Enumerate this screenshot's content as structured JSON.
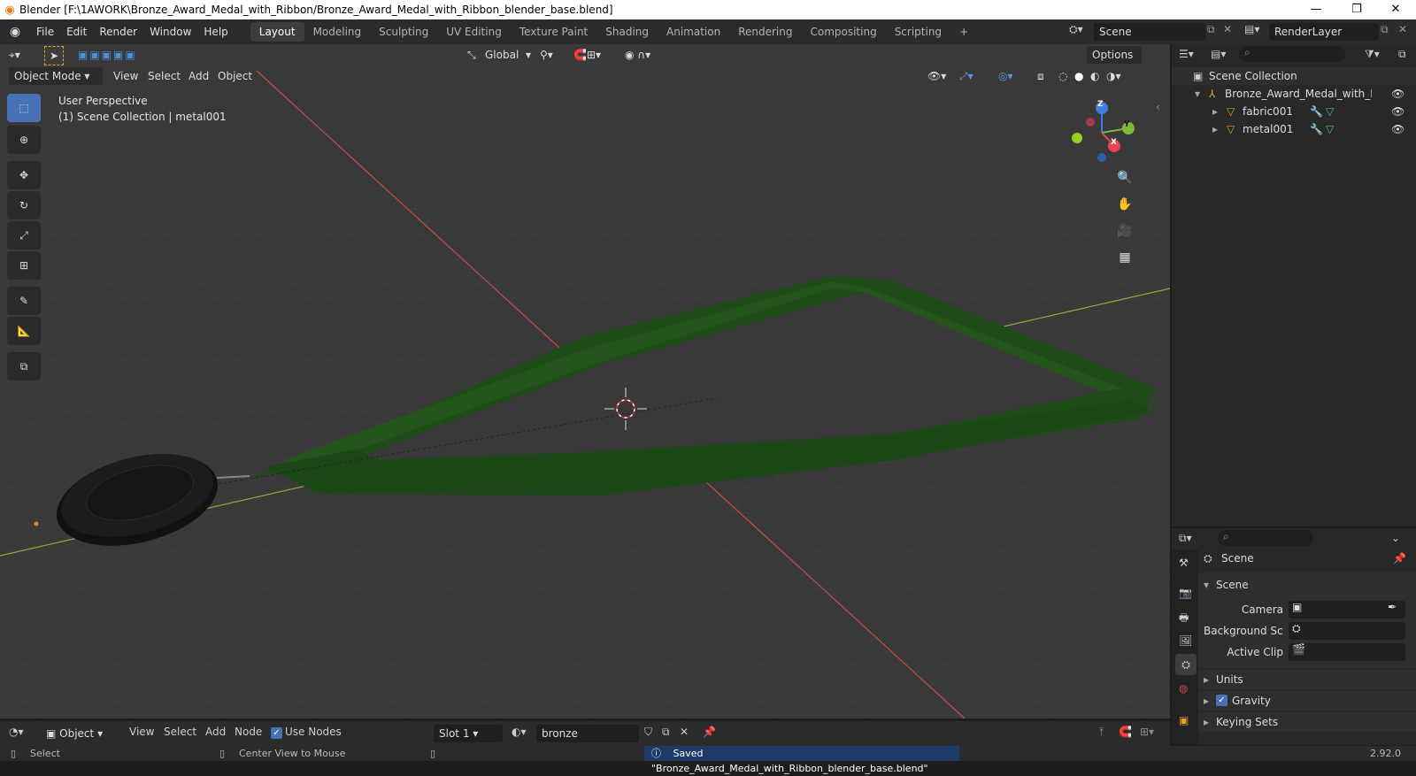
{
  "window": {
    "title": "Blender [F:\\1AWORK\\Bronze_Award_Medal_with_Ribbon/Bronze_Award_Medal_with_Ribbon_blender_base.blend]"
  },
  "menubar": {
    "items": [
      "File",
      "Edit",
      "Render",
      "Window",
      "Help"
    ]
  },
  "workspaces": [
    "Layout",
    "Modeling",
    "Sculpting",
    "UV Editing",
    "Texture Paint",
    "Shading",
    "Animation",
    "Rendering",
    "Compositing",
    "Scripting"
  ],
  "scene_selector": {
    "value": "Scene"
  },
  "render_layer": {
    "value": "RenderLayer"
  },
  "viewport": {
    "orientation": "Global",
    "options_label": "Options",
    "mode": "Object Mode",
    "menus": [
      "View",
      "Select",
      "Add",
      "Object"
    ],
    "perspective_label": "User Perspective",
    "collection_label": "(1) Scene Collection | metal001",
    "gizmo": {
      "z": "Z",
      "y": "Y",
      "x": "X"
    }
  },
  "outliner": {
    "root": "Scene Collection",
    "collection": "Bronze_Award_Medal_with_Ribbon",
    "objects": [
      "fabric001",
      "metal001"
    ]
  },
  "properties": {
    "context": "Scene",
    "panel_title": "Scene",
    "camera_label": "Camera",
    "background_label": "Background Sce...",
    "active_clip_label": "Active Clip",
    "sections": [
      "Units",
      "Gravity",
      "Keying Sets"
    ],
    "gravity_checked": true
  },
  "shader_header": {
    "type": "Object",
    "menus": [
      "View",
      "Select",
      "Add",
      "Node"
    ],
    "use_nodes_label": "Use Nodes",
    "use_nodes_checked": true,
    "slot": "Slot 1",
    "material": "bronze"
  },
  "statusbar": {
    "select": "Select",
    "center_view": "Center View to Mouse",
    "message": "Saved \"Bronze_Award_Medal_with_Ribbon_blender_base.blend\"",
    "version": "2.92.0"
  },
  "colors": {
    "accent": "#4772b3",
    "ribbon": "#1f4f1a",
    "x_axis": "#c94a4a",
    "y_axis": "#8aac3a",
    "viewport_bg": "#393939"
  }
}
